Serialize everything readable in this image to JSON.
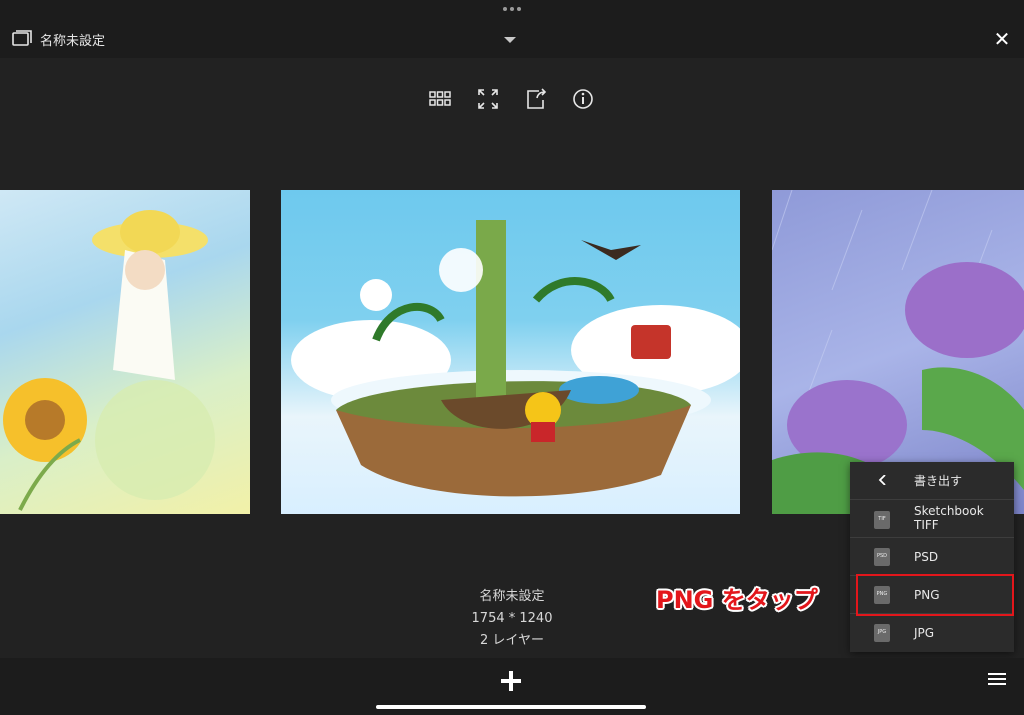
{
  "header": {
    "title": "名称未設定"
  },
  "toolbar": {
    "icons": [
      "grid-view-icon",
      "fullscreen-icon",
      "export-icon",
      "info-icon"
    ]
  },
  "artwork": {
    "info": {
      "name": "名称未設定",
      "dimensions": "1754 * 1240",
      "layers": "2 レイヤー"
    }
  },
  "export_menu": {
    "header_label": "書き出す",
    "options": [
      {
        "label": "Sketchbook\nTIFF",
        "badge": "TIF"
      },
      {
        "label": "PSD",
        "badge": "PSD"
      },
      {
        "label": "PNG",
        "badge": "PNG"
      },
      {
        "label": "JPG",
        "badge": "JPG"
      }
    ]
  },
  "annotation": {
    "callout": "PNG をタップ",
    "color": "#e3161b"
  },
  "colors": {
    "background": "#222222",
    "bar": "#1c1c1c",
    "menu": "#2b2b2b"
  }
}
